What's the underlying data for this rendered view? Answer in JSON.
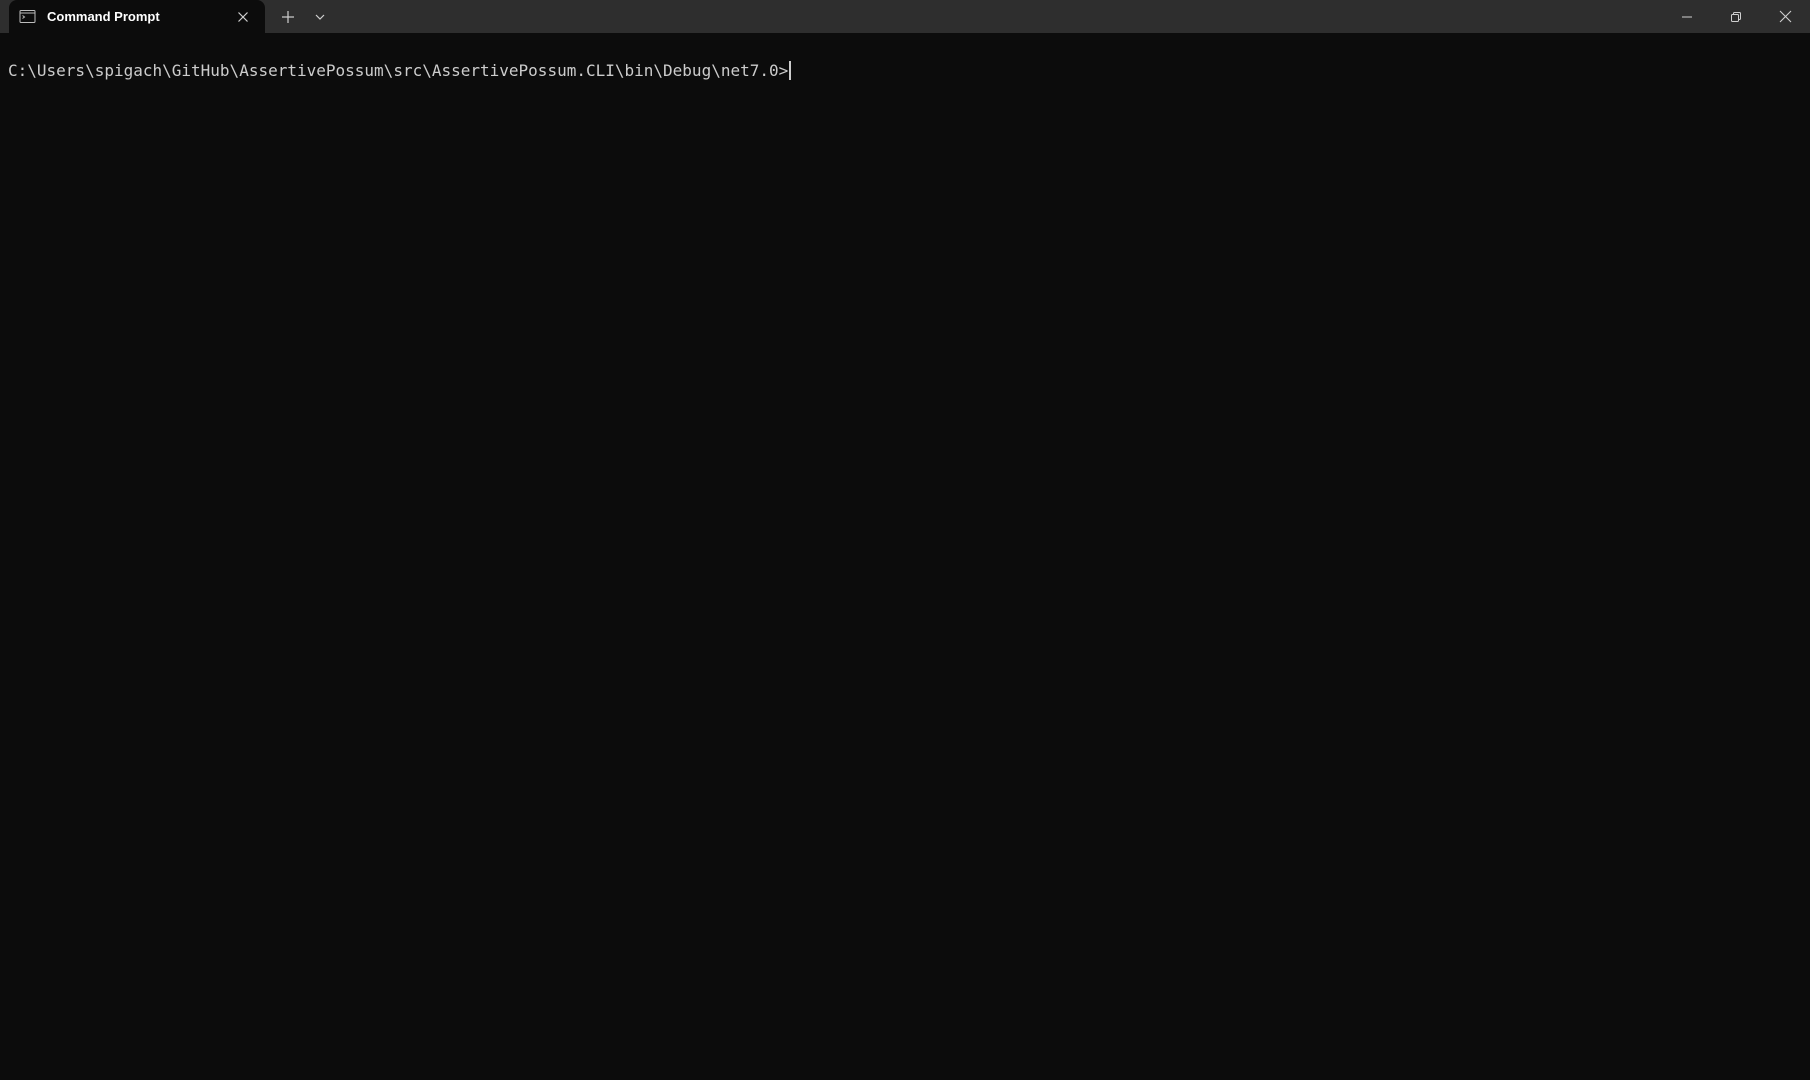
{
  "window": {
    "background": "#0c0c0c",
    "titlebar_color": "#2e2e2e"
  },
  "tab": {
    "title": "Command Prompt",
    "icon": "command-prompt-icon"
  },
  "controls": {
    "new_tab_icon": "plus-icon",
    "dropdown_icon": "chevron-down-icon",
    "minimize_icon": "minimize-icon",
    "maximize_icon": "restore-icon",
    "close_icon": "close-icon"
  },
  "terminal": {
    "prompt": "C:\\Users\\spigach\\GitHub\\AssertivePossum\\src\\AssertivePossum.CLI\\bin\\Debug\\net7.0>",
    "text_color": "#cccccc"
  }
}
